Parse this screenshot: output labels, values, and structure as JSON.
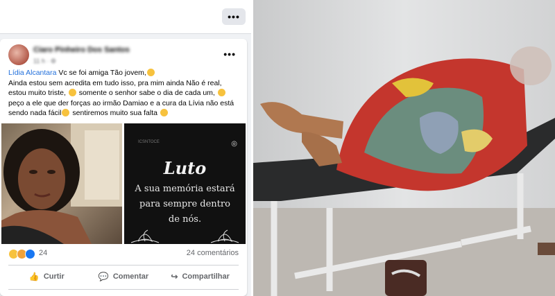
{
  "post": {
    "author": "Ciaro Pinheiro Dos Santos",
    "meta": "11 h · ⚙",
    "mention": "Lídia Alcantara",
    "line1_rest": " Vc se foi amiga Tão jovem,",
    "line2": " Ainda estou sem acredita em tudo isso, pra mim ainda Não é real, estou muito triste,",
    "line3": " somente o senhor sabe o dia de cada um,",
    "line4": " peço a ele que der forças  ao irmão Damiao e a cura da Lívia não está sendo nada fácil",
    "line5": " sentiremos muito sua falta",
    "image_title": "Luto",
    "image_line1": "A sua memória estará",
    "image_line2": "para sempre dentro",
    "image_line3": "de nós.",
    "image_watermark": "ICSNTOCE"
  },
  "stats": {
    "reaction_count": "24",
    "comments": "24 comentários"
  },
  "actions": {
    "like": "Curtir",
    "comment": "Comentar",
    "share": "Compartilhar"
  },
  "icons": {
    "more": "more-icon",
    "like": "thumb-up-icon",
    "comment": "comment-icon",
    "share": "share-icon",
    "instagram": "instagram-icon"
  },
  "colors": {
    "link": "#216fdb",
    "background": "#f0f2f5"
  }
}
